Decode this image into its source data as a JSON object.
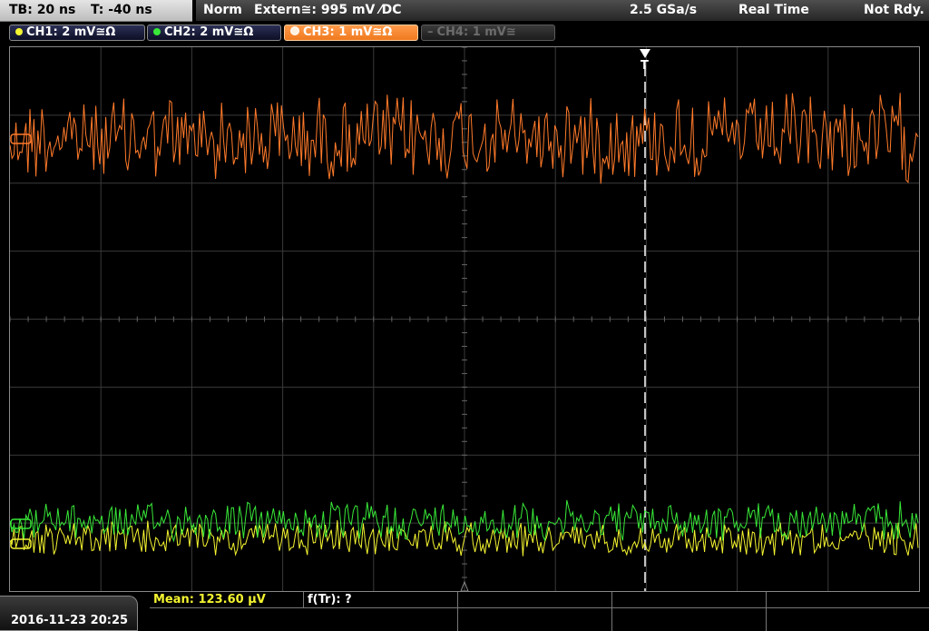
{
  "timebase": {
    "tb": "TB: 20 ns",
    "t": "T: -40 ns"
  },
  "status": {
    "mode": "Norm",
    "trigger": "Extern≅: 995 mV ⁄DC",
    "sample_rate": "2.5 GSa/s",
    "acq": "Real Time",
    "state": "Not Rdy."
  },
  "channels": [
    {
      "label": "CH1: 2 mV≅Ω",
      "color": "#f4f430",
      "state": "on"
    },
    {
      "label": "CH2: 2 mV≅Ω",
      "color": "#38e838",
      "state": "on"
    },
    {
      "label": "CH3: 1 mV≅Ω",
      "color": "#f07a1e",
      "state": "active"
    },
    {
      "label": "CH4: 1 mV≅",
      "color": "#6c6c6c",
      "state": "off"
    }
  ],
  "trigger_marker": "T",
  "measurements": {
    "mean": "Mean: 123.60 µV",
    "freq": "f(Tr): ?"
  },
  "datetime": "2016-11-23 20:25",
  "colors": {
    "ch1": "#f4f430",
    "ch2": "#38e838",
    "ch3": "#ff7a2a",
    "grid": "#3a3a3a"
  }
}
